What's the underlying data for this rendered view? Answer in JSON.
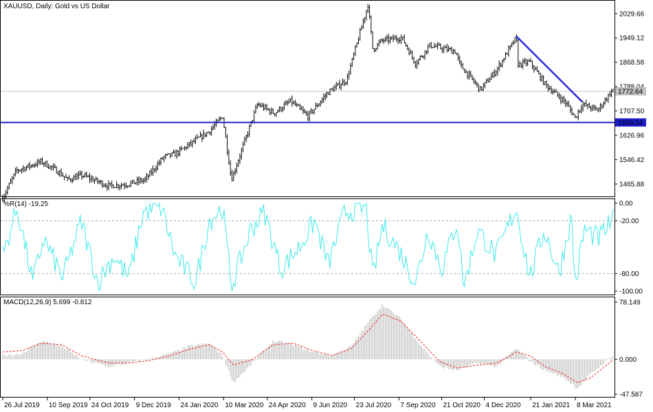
{
  "colors": {
    "bull": "#000000",
    "support": "#1d1dcc",
    "trend": "#2b2bd8",
    "wpr_line": "#3ee8e8",
    "macd_hist": "#b4b4b4",
    "macd_signal": "#ee2222",
    "grid_dash": "#a9a9a9",
    "price_tag_current": "#c0c0c0"
  },
  "chart_data": [
    {
      "type": "candlestick",
      "title": "XAUUSD, Daily:  Gold vs US Dollar",
      "ylim": [
        1425,
        2070
      ],
      "y_ticks": [
        "2029.66",
        "1949.12",
        "1868.58",
        "1788.04",
        "1707.50",
        "1626.96",
        "1546.42",
        "1465.88"
      ],
      "support_level": 1669.54,
      "support_label": "1669.54",
      "current_price": 1772.64,
      "current_label": "1772.64",
      "trendline": {
        "from": [
          "2021-01-06",
          1955
        ],
        "to": [
          "2021-03-15",
          1738
        ]
      },
      "path_x": [
        "2019-07-26",
        "2019-08-09",
        "2019-09-04",
        "2019-09-20",
        "2019-10-01",
        "2019-10-16",
        "2019-11-12",
        "2019-12-01",
        "2019-12-20",
        "2020-01-08",
        "2020-01-20",
        "2020-02-24",
        "2020-03-09",
        "2020-03-18",
        "2020-04-14",
        "2020-05-01",
        "2020-05-18",
        "2020-06-05",
        "2020-06-26",
        "2020-07-15",
        "2020-08-06",
        "2020-08-11",
        "2020-08-20",
        "2020-09-10",
        "2020-09-24",
        "2020-10-09",
        "2020-10-21",
        "2020-11-04",
        "2020-11-09",
        "2020-11-30",
        "2020-12-16",
        "2021-01-06",
        "2021-01-08",
        "2021-01-20",
        "2021-02-05",
        "2021-02-26",
        "2021-03-08",
        "2021-03-15",
        "2021-03-31",
        "2021-04-16"
      ],
      "path_close": [
        1420,
        1510,
        1540,
        1510,
        1480,
        1495,
        1460,
        1465,
        1480,
        1555,
        1565,
        1640,
        1690,
        1480,
        1730,
        1700,
        1740,
        1690,
        1770,
        1810,
        2060,
        1910,
        1940,
        1950,
        1865,
        1925,
        1915,
        1905,
        1860,
        1778,
        1840,
        1950,
        1860,
        1870,
        1795,
        1735,
        1685,
        1730,
        1710,
        1780
      ],
      "x_ticks": [
        "26 Jul 2019",
        "10 Sep 2019",
        "24 Oct 2019",
        "9 Dec 2019",
        "24 Jan 2020",
        "10 Mar 2020",
        "24 Apr 2020",
        "9 Jun 2020",
        "23 Jul 2020",
        "7 Sep 2020",
        "21 Oct 2020",
        "4 Dec 2020",
        "21 Jan 2021",
        "8 Mar 2021"
      ]
    },
    {
      "type": "line",
      "title": "%R(14) -19.25",
      "ylim": [
        -100,
        0
      ],
      "y_ticks": [
        "0.00",
        "-20.00",
        "-80.00",
        "-100.00"
      ],
      "levels": [
        -20,
        -80
      ],
      "path_x": [
        "2019-07-26",
        "2019-08-10",
        "2019-08-26",
        "2019-09-06",
        "2019-09-26",
        "2019-10-15",
        "2019-11-01",
        "2019-11-18",
        "2019-12-03",
        "2019-12-18",
        "2020-01-06",
        "2020-01-20",
        "2020-02-10",
        "2020-02-24",
        "2020-03-09",
        "2020-03-18",
        "2020-04-07",
        "2020-04-21",
        "2020-05-08",
        "2020-05-27",
        "2020-06-12",
        "2020-06-26",
        "2020-07-13",
        "2020-08-04",
        "2020-08-11",
        "2020-08-21",
        "2020-09-08",
        "2020-09-24",
        "2020-10-07",
        "2020-10-21",
        "2020-11-06",
        "2020-11-13",
        "2020-11-27",
        "2020-12-16",
        "2021-01-06",
        "2021-01-20",
        "2021-02-04",
        "2021-02-19",
        "2021-03-04",
        "2021-03-08",
        "2021-03-17",
        "2021-04-01",
        "2021-04-16"
      ],
      "values": [
        -60,
        -5,
        -90,
        -40,
        -85,
        -20,
        -90,
        -60,
        -85,
        -10,
        -5,
        -60,
        -90,
        -20,
        -5,
        -95,
        -30,
        -10,
        -75,
        -50,
        -20,
        -70,
        -10,
        -5,
        -85,
        -25,
        -55,
        -90,
        -30,
        -75,
        -20,
        -95,
        -30,
        -60,
        -5,
        -85,
        -30,
        -80,
        -15,
        -95,
        -30,
        -40,
        -19.25
      ],
      "current_label": "-19.25"
    },
    {
      "type": "bar",
      "title": "MACD(12,26,9) 5.699 -0.812",
      "ylim": [
        -47.587,
        78.149
      ],
      "y_ticks": [
        "78.149",
        "0.000",
        "-47.587"
      ],
      "path_x": [
        "2019-07-26",
        "2019-08-15",
        "2019-09-04",
        "2019-09-25",
        "2019-10-15",
        "2019-11-12",
        "2019-12-03",
        "2019-12-23",
        "2020-01-15",
        "2020-02-04",
        "2020-02-24",
        "2020-03-09",
        "2020-03-20",
        "2020-04-09",
        "2020-04-30",
        "2020-05-21",
        "2020-06-10",
        "2020-06-30",
        "2020-07-20",
        "2020-08-07",
        "2020-08-21",
        "2020-09-09",
        "2020-09-29",
        "2020-10-19",
        "2020-11-06",
        "2020-11-27",
        "2020-12-17",
        "2021-01-06",
        "2021-01-20",
        "2021-02-05",
        "2021-02-24",
        "2021-03-10",
        "2021-03-24",
        "2021-04-16"
      ],
      "macd": [
        5,
        8,
        25,
        18,
        0,
        -10,
        -5,
        0,
        8,
        18,
        22,
        5,
        -32,
        -5,
        25,
        20,
        10,
        5,
        18,
        52,
        75,
        55,
        20,
        -10,
        -15,
        -5,
        -10,
        15,
        -2,
        -15,
        -25,
        -40,
        -20,
        5.699
      ],
      "signal": [
        10,
        12,
        22,
        20,
        5,
        -5,
        -5,
        -2,
        5,
        14,
        20,
        10,
        -8,
        0,
        20,
        22,
        12,
        5,
        15,
        40,
        62,
        52,
        25,
        -3,
        -12,
        -8,
        -5,
        10,
        5,
        -10,
        -20,
        -32,
        -25,
        -0.812
      ]
    }
  ]
}
